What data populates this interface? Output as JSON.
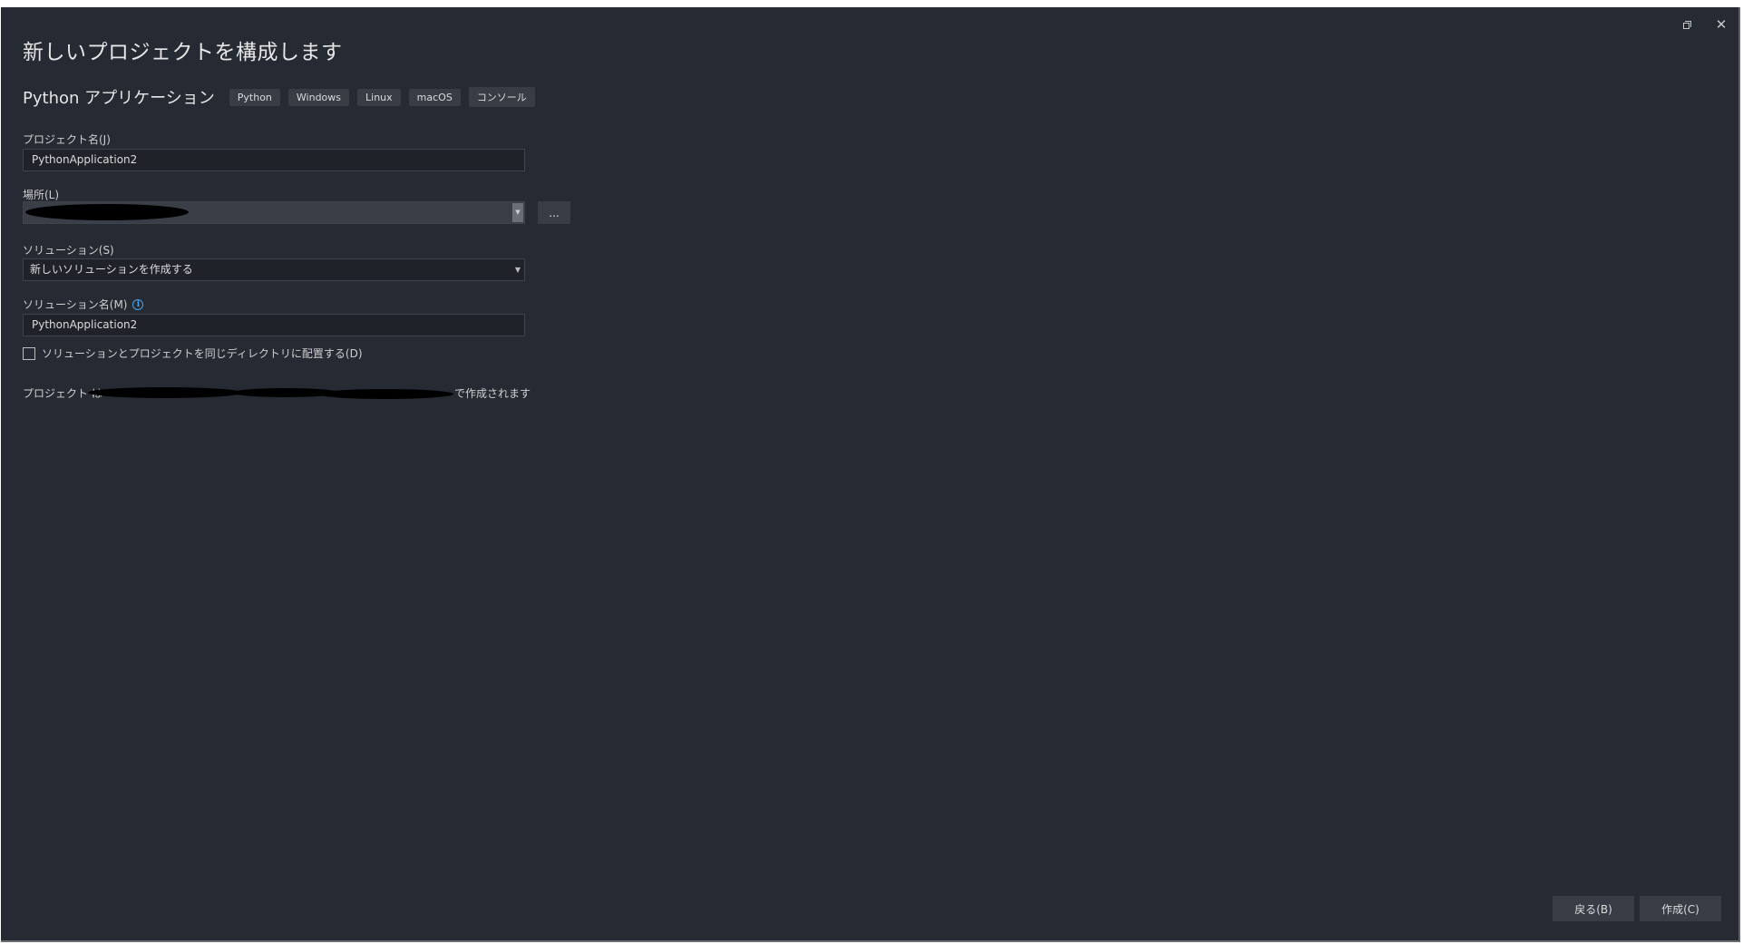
{
  "window": {
    "restore_icon": "restore-icon",
    "close_icon": "close-icon",
    "close_glyph": "✕"
  },
  "page_title": "新しいプロジェクトを構成します",
  "template": {
    "name": "Python アプリケーション",
    "tags": [
      "Python",
      "Windows",
      "Linux",
      "macOS",
      "コンソール"
    ]
  },
  "project_name": {
    "label": "プロジェクト名(J)",
    "value": "PythonApplication2"
  },
  "location": {
    "label": "場所(L)",
    "value": "",
    "browse_label": "..."
  },
  "solution": {
    "label": "ソリューション(S)",
    "value": "新しいソリューションを作成する"
  },
  "solution_name": {
    "label": "ソリューション名(M)",
    "info_glyph": "i",
    "value": "PythonApplication2"
  },
  "same_directory": {
    "label": "ソリューションとプロジェクトを同じディレクトリに配置する(D)",
    "checked": false
  },
  "summary": {
    "prefix": "プロジェクト は",
    "suffix": "で作成されます"
  },
  "buttons": {
    "back": "戻る(B)",
    "create": "作成(C)"
  },
  "colors": {
    "background": "#262a33",
    "input_background": "#1f2229",
    "tag_background": "#383c45",
    "info_accent": "#4aa3e8"
  }
}
